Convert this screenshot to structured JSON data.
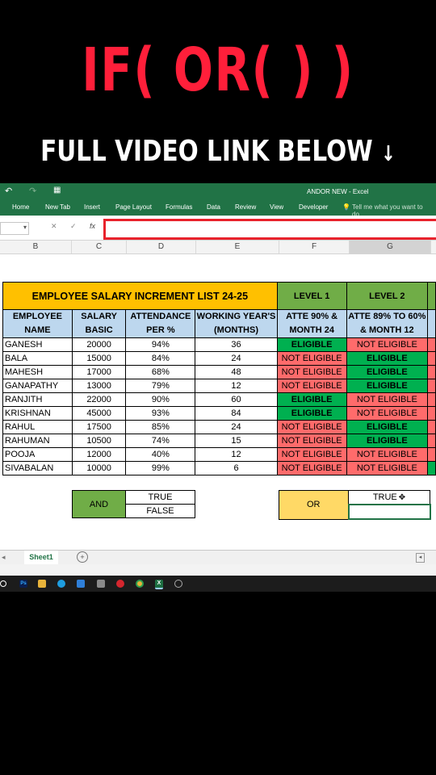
{
  "overlay": {
    "title": "IF( OR( ) )",
    "subtitle": "FULL VIDEO LINK BELOW",
    "subtitle_arrow": "↓"
  },
  "window": {
    "title": "ANDOR NEW - Excel"
  },
  "ribbon": {
    "tabs": [
      "Home",
      "New Tab",
      "Insert",
      "Page Layout",
      "Formulas",
      "Data",
      "Review",
      "View",
      "Developer"
    ],
    "tell_me": "Tell me what you want to do..."
  },
  "formula_bar": {
    "fx": "fx",
    "cancel": "✕",
    "enter": "✓"
  },
  "columns": [
    "B",
    "C",
    "D",
    "E",
    "F",
    "G"
  ],
  "table": {
    "title": "EMPLOYEE SALARY INCREMENT LIST 24-25",
    "level1": "LEVEL 1",
    "level2": "LEVEL 2",
    "headers": {
      "name": "EMPLOYEE NAME",
      "salary": "SALARY BASIC",
      "attendance": "ATTENDANCE PER %",
      "working": "WORKING YEAR'S (MONTHS)",
      "level1_rule": "ATTE 90% & MONTH 24",
      "level2_rule": "ATTE 89% TO 60% & MONTH 12"
    },
    "rows": [
      {
        "name": "GANESH",
        "salary": "20000",
        "att": "94%",
        "months": "36",
        "l1": "ELIGIBLE",
        "l2": "NOT ELIGIBLE"
      },
      {
        "name": "BALA",
        "salary": "15000",
        "att": "84%",
        "months": "24",
        "l1": "NOT ELIGIBLE",
        "l2": "ELIGIBLE"
      },
      {
        "name": "MAHESH",
        "salary": "17000",
        "att": "68%",
        "months": "48",
        "l1": "NOT ELIGIBLE",
        "l2": "ELIGIBLE"
      },
      {
        "name": "GANAPATHY",
        "salary": "13000",
        "att": "79%",
        "months": "12",
        "l1": "NOT ELIGIBLE",
        "l2": "ELIGIBLE"
      },
      {
        "name": "RANJITH",
        "salary": "22000",
        "att": "90%",
        "months": "60",
        "l1": "ELIGIBLE",
        "l2": "NOT ELIGIBLE"
      },
      {
        "name": "KRISHNAN",
        "salary": "45000",
        "att": "93%",
        "months": "84",
        "l1": "ELIGIBLE",
        "l2": "NOT ELIGIBLE"
      },
      {
        "name": "RAHUL",
        "salary": "17500",
        "att": "85%",
        "months": "24",
        "l1": "NOT ELIGIBLE",
        "l2": "ELIGIBLE"
      },
      {
        "name": "RAHUMAN",
        "salary": "10500",
        "att": "74%",
        "months": "15",
        "l1": "NOT ELIGIBLE",
        "l2": "ELIGIBLE"
      },
      {
        "name": "POOJA",
        "salary": "12000",
        "att": "40%",
        "months": "12",
        "l1": "NOT ELIGIBLE",
        "l2": "NOT ELIGIBLE"
      },
      {
        "name": "SIVABALAN",
        "salary": "10000",
        "att": "99%",
        "months": "6",
        "l1": "NOT ELIGIBLE",
        "l2": "NOT ELIGIBLE"
      }
    ]
  },
  "and_box": {
    "label": "AND",
    "true": "TRUE",
    "false": "FALSE"
  },
  "or_box": {
    "label": "OR",
    "true": "TRUE",
    "empty": ""
  },
  "sheet_tab": "Sheet1",
  "colors": {
    "excel_green": "#217346",
    "highlight_red": "#e8222c",
    "eligible": "#00b050",
    "not_eligible": "#ff6b6b"
  }
}
